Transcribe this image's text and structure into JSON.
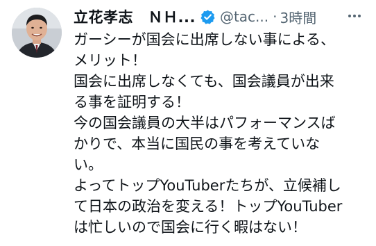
{
  "tweet": {
    "author_name": "立花孝志　ＮＨ...",
    "handle": "@tac...",
    "separator": "·",
    "time": "3時間",
    "icons": {
      "verified": "verified-badge-icon",
      "more": "more-options-icon",
      "avatar": "avatar"
    },
    "colors": {
      "verified": "#1d9bf0",
      "text": "#0f1419",
      "secondary": "#536471"
    },
    "text_lines": [
      "ガーシーが国会に出席しない事による、",
      "メリット！",
      "国会に出席しなくても、国会議員が出来",
      "る事を証明する！",
      "今の国会議員の大半はパフォーマンスば",
      "かりで、本当に国民の事を考えていな",
      "い。",
      "よってトップYouTuberたちが、立候補し",
      "て日本の政治を変える！トップYouTuber",
      "は忙しいので国会に行く暇はない！"
    ]
  }
}
